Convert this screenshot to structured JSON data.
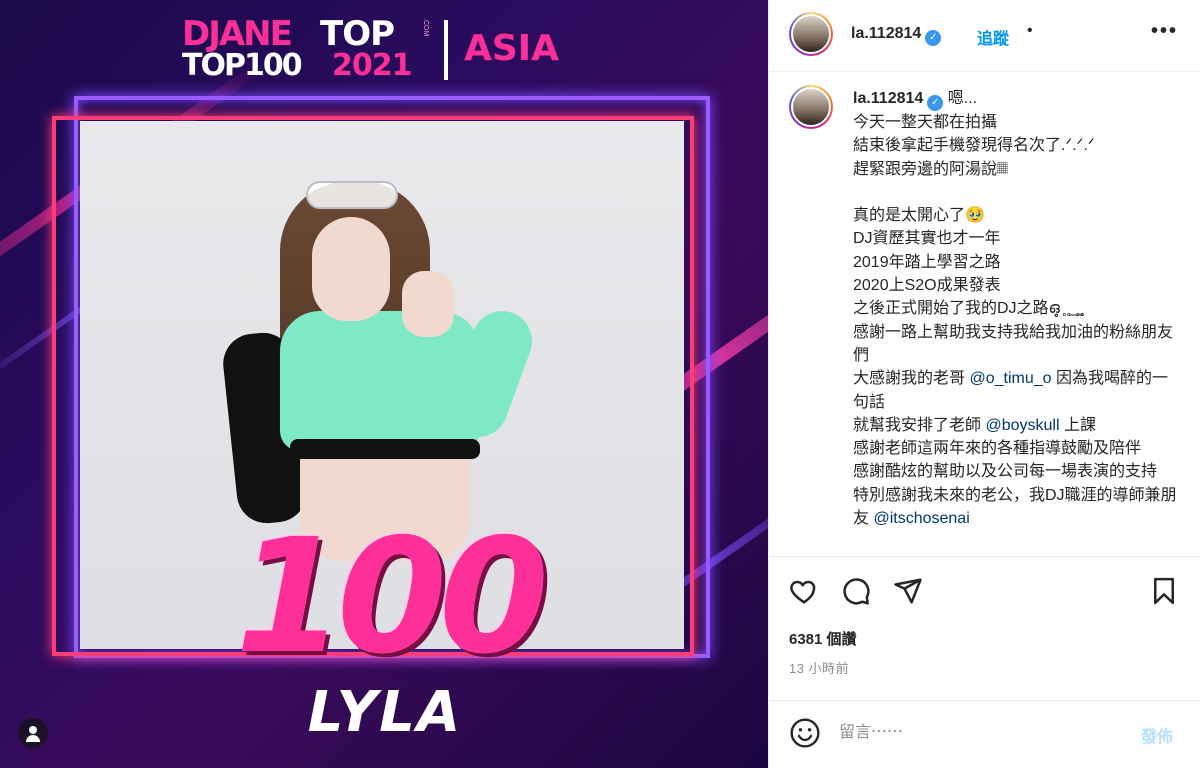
{
  "media": {
    "logo": {
      "brand": "DJANE",
      "brand_top": "TOP",
      "domain_suffix": ".COM",
      "list_name": "TOP100",
      "year": "2021",
      "region": "ASIA"
    },
    "rank": "100",
    "artist_name": "LYLA",
    "colors": {
      "neon_pink": "#ff2f9a",
      "neon_purple": "#9a5cff",
      "background": "#2a0b5e"
    }
  },
  "post_header": {
    "username": "la.112814",
    "verified": true,
    "separator": "•",
    "follow_label": "追蹤",
    "more_label": "•••"
  },
  "caption": {
    "username": "la.112814",
    "lines": [
      " 嗯...",
      "今天一整天都在拍攝",
      "結束後拿起手機發現得名次了.ᐟ.ᐟ.ᐟ",
      "趕緊跟旁邊的阿湯說𝄜",
      "",
      "真的是太開心了🥹",
      "DJ資歷其實也才一年",
      "2019年踏上學習之路",
      "2020上S2O成果發表",
      "之後正式開始了我的DJ之路ഒ̥̥ ̥ ̥ ͟ ̥ ̥̥",
      "感謝一路上幫助我支持我給我加油的粉絲朋友們"
    ],
    "line_thanks_brother_prefix": "大感謝我的老哥 ",
    "mention_brother": "@o_timu_o",
    "line_thanks_brother_suffix": " 因為我喝醉的一句話",
    "line_teacher_prefix": "就幫我安排了老師 ",
    "mention_teacher": "@boyskull",
    "line_teacher_suffix": " 上課",
    "line_thanks_teacher": "感謝老師這兩年來的各種指導鼓勵及陪伴",
    "line_thanks_company": "感謝酷炫的幫助以及公司每一場表演的支持",
    "line_husband_prefix": "特別感謝我未來的老公，我DJ職涯的導師兼朋友 ",
    "mention_husband": "@itschosenai"
  },
  "actions": {
    "like_icon": "heart-icon",
    "comment_icon": "comment-icon",
    "share_icon": "send-icon",
    "save_icon": "bookmark-icon"
  },
  "stats": {
    "views": "6381 個讚",
    "timestamp": "13 小時前"
  },
  "comment": {
    "emoji_icon": "smiley-icon",
    "placeholder": "留言⋯⋯",
    "post_label": "發佈",
    "post_disabled_color": "#b2dffc"
  }
}
